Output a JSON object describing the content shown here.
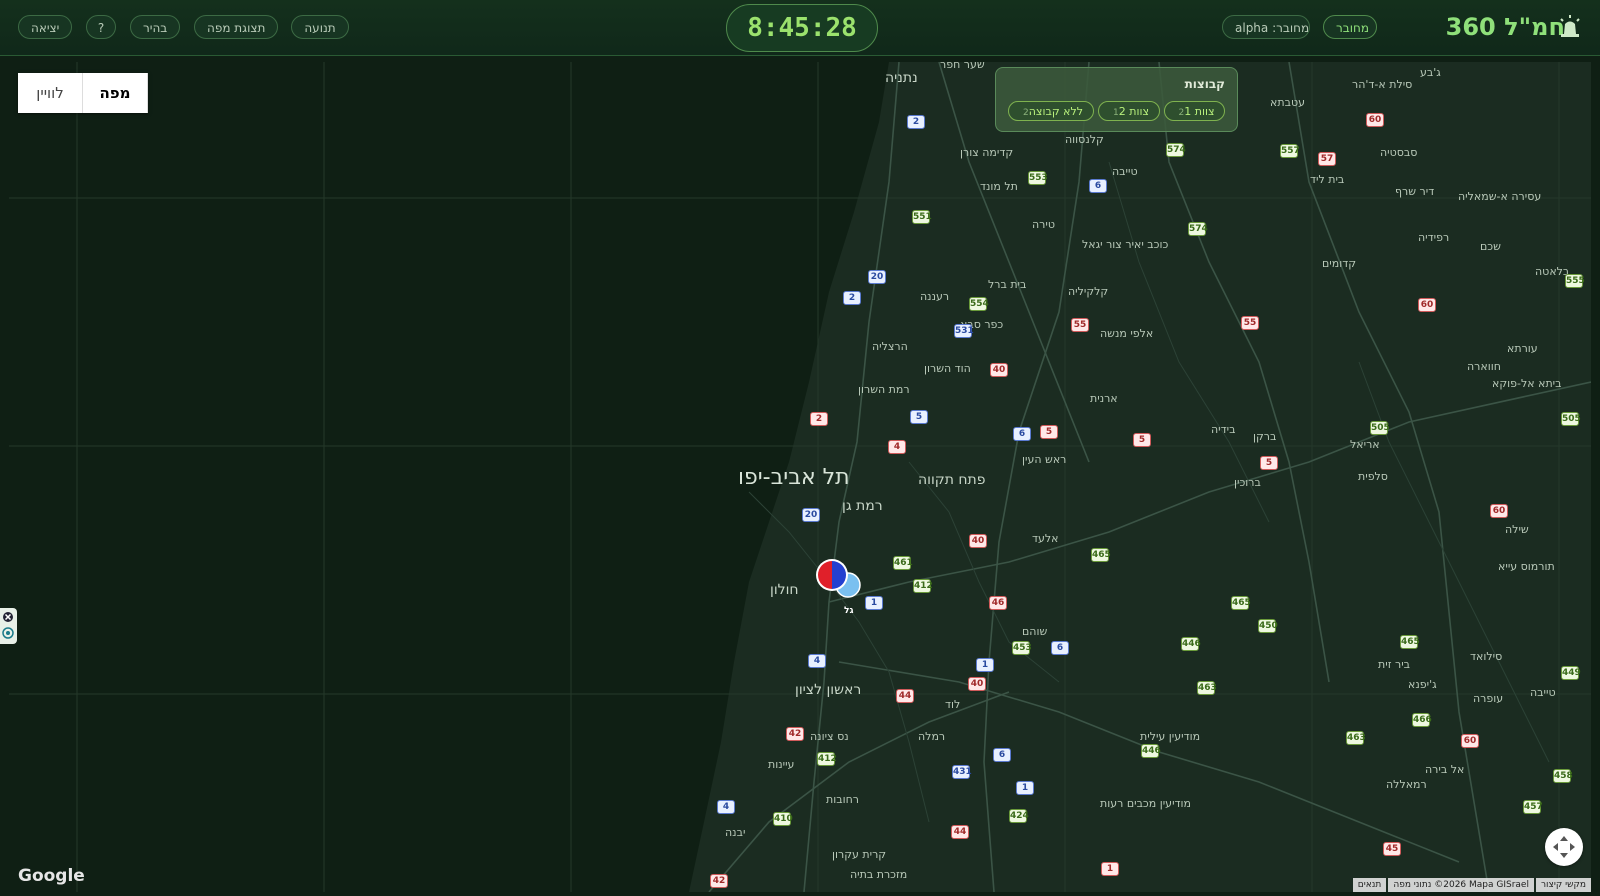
{
  "header": {
    "brand": "חמ\"ל 360",
    "clock": "8:45:28",
    "status_connected": "מחובר",
    "status_user": "alpha :מחובר",
    "menu": [
      "תנועה",
      "תצוגת מפה",
      "בהיר",
      "?",
      "יציאה"
    ]
  },
  "view_toggle": {
    "map": "מפה",
    "list": "לוויין"
  },
  "groups": {
    "title": "קבוצות",
    "chips": [
      {
        "label": "צוות 1",
        "count": "2"
      },
      {
        "label": "צוות 2",
        "count": "1"
      },
      {
        "label": "ללא קבוצה",
        "count": "2"
      }
    ]
  },
  "map": {
    "cities": [
      {
        "name": "תל אביב-יפו",
        "size": "big"
      },
      {
        "name": "פתח תקווה",
        "size": "med"
      },
      {
        "name": "רמת גן",
        "size": "med"
      },
      {
        "name": "חולון",
        "size": "med"
      },
      {
        "name": "ראשון לציון",
        "size": "med"
      },
      {
        "name": "נתניה",
        "size": "med"
      },
      {
        "name": "הרצליה",
        "size": "small"
      },
      {
        "name": "רעננה",
        "size": "small"
      },
      {
        "name": "כפר סבא",
        "size": "small"
      },
      {
        "name": "הוד השרון",
        "size": "small"
      },
      {
        "name": "רמת השרון",
        "size": "small"
      },
      {
        "name": "ראש העין",
        "size": "small"
      },
      {
        "name": "אלעד",
        "size": "small"
      },
      {
        "name": "שוהם",
        "size": "small"
      },
      {
        "name": "לוד",
        "size": "small"
      },
      {
        "name": "רמלה",
        "size": "small"
      },
      {
        "name": "נס ציונה",
        "size": "small"
      },
      {
        "name": "עיינות",
        "size": "small"
      },
      {
        "name": "רחובות",
        "size": "small"
      },
      {
        "name": "יבנה",
        "size": "small"
      },
      {
        "name": "קרית עקרון",
        "size": "small"
      },
      {
        "name": "מזכרת בתיה",
        "size": "small"
      },
      {
        "name": "מודיעין עילית",
        "size": "small"
      },
      {
        "name": "מודיעין מכבים רעות",
        "size": "small"
      },
      {
        "name": "טירה",
        "size": "small"
      },
      {
        "name": "טייבה",
        "size": "small"
      },
      {
        "name": "קלנסווה",
        "size": "small"
      },
      {
        "name": "קדימה צורן",
        "size": "small"
      },
      {
        "name": "תל מונד",
        "size": "small"
      },
      {
        "name": "כוכב יאיר צור יגאל",
        "size": "small"
      },
      {
        "name": "בית ברל",
        "size": "small"
      },
      {
        "name": "קלקיליה",
        "size": "small"
      },
      {
        "name": "אלפי מנשה",
        "size": "small"
      },
      {
        "name": "ארנית",
        "size": "small"
      },
      {
        "name": "בידיה",
        "size": "small"
      },
      {
        "name": "ברקן",
        "size": "small"
      },
      {
        "name": "ברוכין",
        "size": "small"
      },
      {
        "name": "אריאל",
        "size": "small"
      },
      {
        "name": "סלפית",
        "size": "small"
      },
      {
        "name": "שילה",
        "size": "small"
      },
      {
        "name": "תורמוס עייא",
        "size": "small"
      },
      {
        "name": "סילואד",
        "size": "small"
      },
      {
        "name": "עופרה",
        "size": "small"
      },
      {
        "name": "טייבה",
        "size": "small"
      },
      {
        "name": "ביר זית",
        "size": "small"
      },
      {
        "name": "ג'יפנא",
        "size": "small"
      },
      {
        "name": "אל בירה",
        "size": "small"
      },
      {
        "name": "רמאללה",
        "size": "small"
      },
      {
        "name": "חווארה",
        "size": "small"
      },
      {
        "name": "ביתא אל-פוקא",
        "size": "small"
      },
      {
        "name": "עורתא",
        "size": "small"
      },
      {
        "name": "קדומים",
        "size": "small"
      },
      {
        "name": "רפידיה",
        "size": "small"
      },
      {
        "name": "שכם",
        "size": "small"
      },
      {
        "name": "בלאטה",
        "size": "small"
      },
      {
        "name": "עסירה א-שמאליה",
        "size": "small"
      },
      {
        "name": "דיר שרף",
        "size": "small"
      },
      {
        "name": "סבסטיה",
        "size": "small"
      },
      {
        "name": "בית ליד",
        "size": "small"
      },
      {
        "name": "עטבתא",
        "size": "small"
      },
      {
        "name": "סילת א-ד'הר",
        "size": "small"
      },
      {
        "name": "ג'בע",
        "size": "small"
      },
      {
        "name": "שער חפר",
        "size": "small"
      }
    ],
    "marker_label": "גל",
    "google": "Google",
    "attribution": [
      "מקשי קיצור",
      "נתוני מפה ‎©2026 Mapa GISrael",
      "תנאים"
    ]
  },
  "colors": {
    "accent": "#8fe07a",
    "header_bg": "#10281a",
    "sea": "#0f1f14",
    "land": "#1a2a1f"
  },
  "icons": [
    "siren-icon",
    "fullscreen-icon",
    "close-icon",
    "refresh-icon"
  ]
}
